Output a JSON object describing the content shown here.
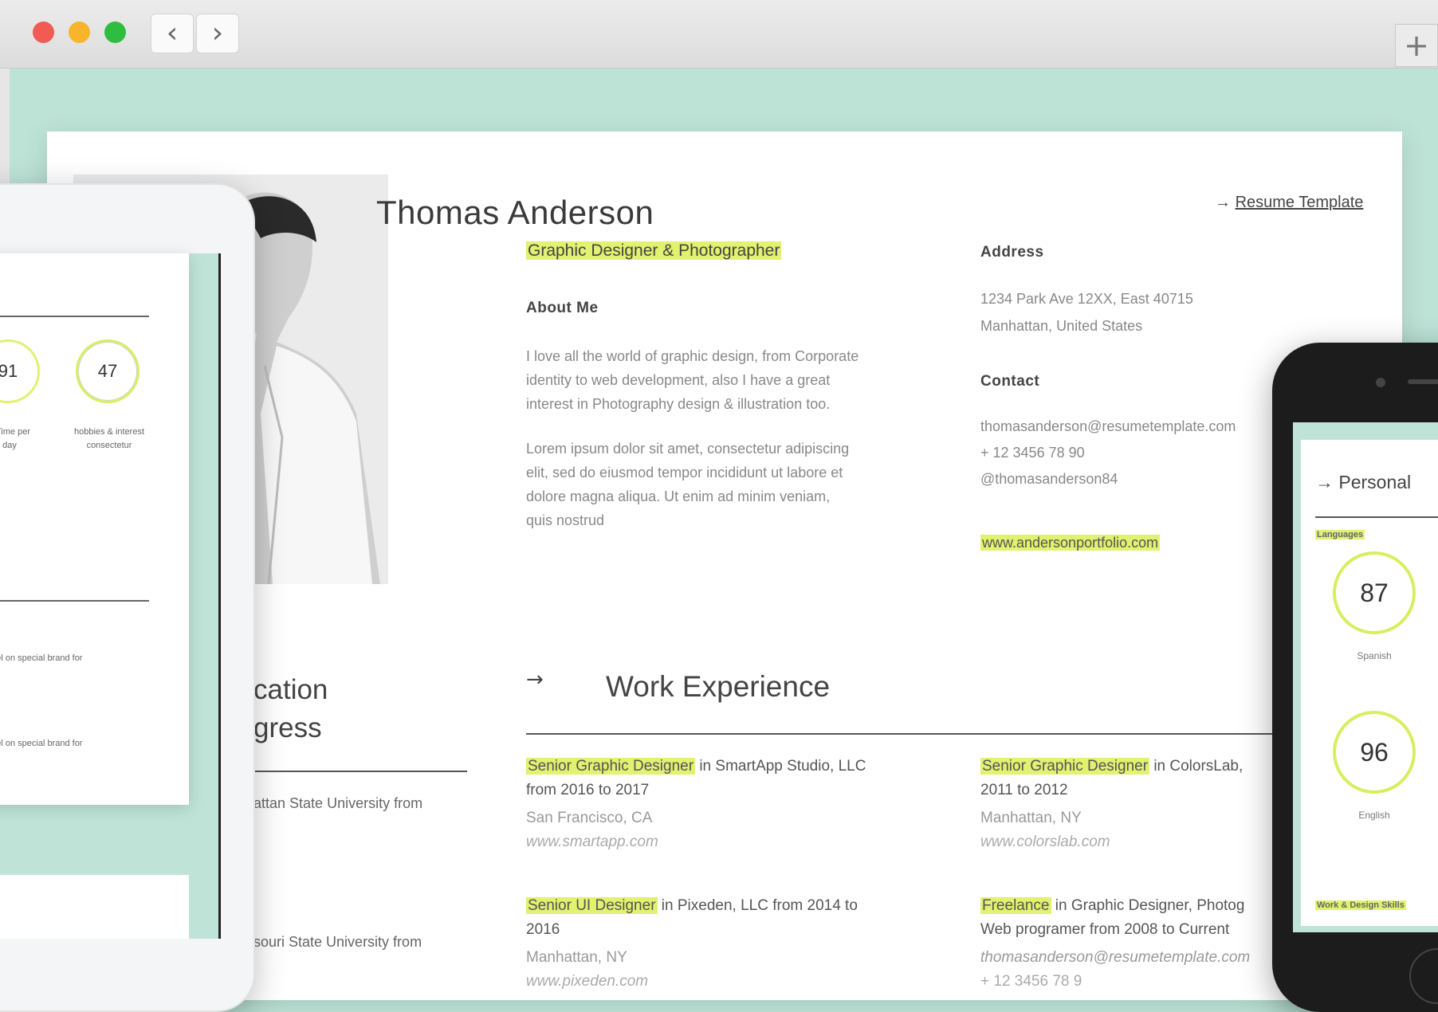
{
  "browser": {
    "back_icon": "‹",
    "forward_icon": "›",
    "new_tab_icon": "+"
  },
  "resume": {
    "name": "Thomas Anderson",
    "subtitle": "Graphic Designer & Photographer",
    "top_link": "Resume Template",
    "about": {
      "heading": "About Me",
      "p1": [
        "I love all the world of graphic design, from Corporate",
        "identity to web development, also I have a great",
        "interest in Photography design & illustration too."
      ],
      "p2": [
        "Lorem ipsum dolor sit amet, consectetur adipiscing",
        "elit, sed do eiusmod tempor incididunt ut labore et",
        "dolore magna aliqua. Ut enim ad minim veniam,",
        "quis nostrud"
      ]
    },
    "address": {
      "heading": "Address",
      "lines": [
        "1234 Park Ave 12XX, East 40715",
        "Manhattan, United States"
      ]
    },
    "contact": {
      "heading": "Contact",
      "lines": [
        "thomasanderson@resumetemplate.com",
        "+ 12 3456 78 90",
        "@thomasanderson84"
      ],
      "website": "www.andersonportfolio.com"
    },
    "education": {
      "title_line1": "cation",
      "title_line2": "gress",
      "items": [
        "attan State University from",
        "souri State University from"
      ]
    },
    "work": {
      "title": "Work Experience",
      "jobs": [
        {
          "role": "Senior Graphic Designer",
          "rest": " in SmartApp Studio, LLC",
          "line2": "from 2016 to 2017",
          "loc": "San Francisco, CA",
          "url": "www.smartapp.com"
        },
        {
          "role": "Senior Graphic Designer",
          "rest": " in ColorsLab,",
          "line2": "2011 to 2012",
          "loc": "Manhattan, NY",
          "url": "www.colorslab.com"
        },
        {
          "role": "Senior UI Designer",
          "rest": " in Pixeden, LLC from 2014 to",
          "line2": "2016",
          "loc": "Manhattan, NY",
          "url": "www.pixeden.com"
        },
        {
          "role": "Freelance",
          "rest": " in Graphic Designer, Photog",
          "line2": "Web programer from 2008 to Current",
          "loc": "thomasanderson@resumetemplate.com",
          "url": "+ 12 3456 78 9"
        }
      ]
    }
  },
  "tablet": {
    "ring1": "91",
    "ring2": "47",
    "ring1_label": [
      "e Time per",
      "day"
    ],
    "ring2_label": [
      "hobbies & interest",
      "consectetur"
    ],
    "small1": "s label on special brand for",
    "small2": "s label on special brand for"
  },
  "phone": {
    "title": "Personal",
    "label": "Languages",
    "ring1": "87",
    "ring1_label": "Spanish",
    "ring2": "96",
    "ring2_label": "English",
    "bottom_label": "Work & Design Skills"
  },
  "colors": {
    "highlight": "#e1f170",
    "bg": "#bde3d7"
  }
}
